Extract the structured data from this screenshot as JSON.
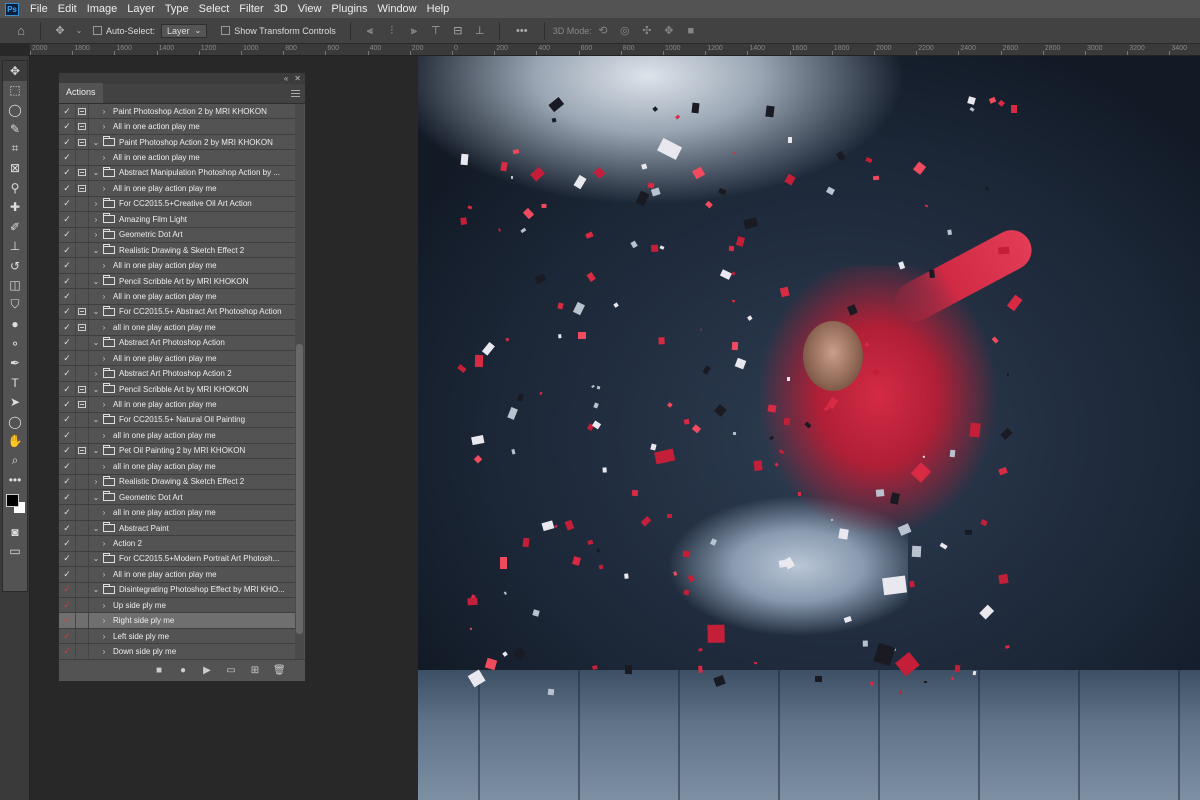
{
  "app": {
    "logo_text": "Ps"
  },
  "menubar": [
    "File",
    "Edit",
    "Image",
    "Layer",
    "Type",
    "Select",
    "Filter",
    "3D",
    "View",
    "Plugins",
    "Window",
    "Help"
  ],
  "options_bar": {
    "auto_select_label": "Auto-Select:",
    "auto_select_value": "Layer",
    "show_transform_label": "Show Transform Controls",
    "more_label": "•••",
    "mode_3d_label": "3D Mode:"
  },
  "ruler_top": [
    "2000",
    "1800",
    "1600",
    "1400",
    "1200",
    "1000",
    "800",
    "600",
    "400",
    "200",
    "0",
    "200",
    "400",
    "600",
    "800",
    "1000",
    "1200",
    "1400",
    "1600",
    "1800",
    "2000",
    "2200",
    "2400",
    "2600",
    "2800",
    "3000",
    "3200",
    "3400"
  ],
  "tools": [
    {
      "name": "move-tool-icon",
      "glyph": "✥"
    },
    {
      "name": "marquee-tool-icon",
      "glyph": "⬚"
    },
    {
      "name": "lasso-tool-icon",
      "glyph": "◯"
    },
    {
      "name": "quick-select-tool-icon",
      "glyph": "✎"
    },
    {
      "name": "crop-tool-icon",
      "glyph": "⌗"
    },
    {
      "name": "frame-tool-icon",
      "glyph": "⊠"
    },
    {
      "name": "eyedropper-tool-icon",
      "glyph": "⚲"
    },
    {
      "name": "healing-brush-tool-icon",
      "glyph": "✚"
    },
    {
      "name": "brush-tool-icon",
      "glyph": "✐"
    },
    {
      "name": "clone-stamp-tool-icon",
      "glyph": "⊥"
    },
    {
      "name": "history-brush-tool-icon",
      "glyph": "↺"
    },
    {
      "name": "eraser-tool-icon",
      "glyph": "◫"
    },
    {
      "name": "paint-bucket-tool-icon",
      "glyph": "⛉"
    },
    {
      "name": "blur-tool-icon",
      "glyph": "●"
    },
    {
      "name": "dodge-tool-icon",
      "glyph": "⚬"
    },
    {
      "name": "pen-tool-icon",
      "glyph": "✒"
    },
    {
      "name": "type-tool-icon",
      "glyph": "T"
    },
    {
      "name": "path-select-tool-icon",
      "glyph": "➤"
    },
    {
      "name": "ellipse-tool-icon",
      "glyph": "◯"
    },
    {
      "name": "hand-tool-icon",
      "glyph": "✋"
    },
    {
      "name": "zoom-tool-icon",
      "glyph": "⌕"
    },
    {
      "name": "more-tools-icon",
      "glyph": "•••"
    }
  ],
  "actions_panel": {
    "tab_label": "Actions",
    "rows": [
      {
        "check": "✓",
        "red": false,
        "dialog": true,
        "twirl": "›",
        "folder": false,
        "label": "Paint Photoshop Action 2 by MRI KHOKON"
      },
      {
        "check": "✓",
        "red": false,
        "dialog": true,
        "twirl": "›",
        "folder": false,
        "label": "All in one action play me"
      },
      {
        "check": "✓",
        "red": false,
        "dialog": true,
        "twirl": "⌄",
        "folder": true,
        "label": "Paint Photoshop Action 2 by MRI KHOKON"
      },
      {
        "check": "✓",
        "red": false,
        "dialog": false,
        "twirl": "›",
        "folder": false,
        "label": "All in one action play me"
      },
      {
        "check": "✓",
        "red": false,
        "dialog": true,
        "twirl": "⌄",
        "folder": true,
        "label": "Abstract Manipulation Photoshop Action by ..."
      },
      {
        "check": "✓",
        "red": false,
        "dialog": true,
        "twirl": "›",
        "folder": false,
        "label": "All in one play action play me"
      },
      {
        "check": "✓",
        "red": false,
        "dialog": false,
        "twirl": "›",
        "folder": true,
        "label": "For CC2015.5+Creative Oil Art Action"
      },
      {
        "check": "✓",
        "red": false,
        "dialog": false,
        "twirl": "›",
        "folder": true,
        "label": "Amazing Film Light"
      },
      {
        "check": "✓",
        "red": false,
        "dialog": false,
        "twirl": "›",
        "folder": true,
        "label": "Geometric Dot Art"
      },
      {
        "check": "✓",
        "red": false,
        "dialog": false,
        "twirl": "⌄",
        "folder": true,
        "label": "Realistic Drawing & Sketch Effect 2"
      },
      {
        "check": "✓",
        "red": false,
        "dialog": false,
        "twirl": "›",
        "folder": false,
        "label": "All in one play action play me"
      },
      {
        "check": "✓",
        "red": false,
        "dialog": false,
        "twirl": "⌄",
        "folder": true,
        "label": "Pencil Scribble Art by MRI KHOKON"
      },
      {
        "check": "✓",
        "red": false,
        "dialog": false,
        "twirl": "›",
        "folder": false,
        "label": "All in one play action play me"
      },
      {
        "check": "✓",
        "red": false,
        "dialog": true,
        "twirl": "⌄",
        "folder": true,
        "label": "For CC2015.5+ Abstract Art Photoshop Action"
      },
      {
        "check": "✓",
        "red": false,
        "dialog": true,
        "twirl": "›",
        "folder": false,
        "label": "all in one play action play me"
      },
      {
        "check": "✓",
        "red": false,
        "dialog": false,
        "twirl": "⌄",
        "folder": true,
        "label": "Abstract Art Photoshop Action"
      },
      {
        "check": "✓",
        "red": false,
        "dialog": false,
        "twirl": "›",
        "folder": false,
        "label": "All in one play action play me"
      },
      {
        "check": "✓",
        "red": false,
        "dialog": false,
        "twirl": "›",
        "folder": true,
        "label": "Abstract Art Photoshop Action 2"
      },
      {
        "check": "✓",
        "red": false,
        "dialog": true,
        "twirl": "⌄",
        "folder": true,
        "label": "Pencil Scribble Art by MRI KHOKON"
      },
      {
        "check": "✓",
        "red": false,
        "dialog": true,
        "twirl": "›",
        "folder": false,
        "label": "All in one play action play me"
      },
      {
        "check": "✓",
        "red": false,
        "dialog": false,
        "twirl": "⌄",
        "folder": true,
        "label": "For CC2015.5+ Natural Oil Painting"
      },
      {
        "check": "✓",
        "red": false,
        "dialog": false,
        "twirl": "›",
        "folder": false,
        "label": "all in one play action play me"
      },
      {
        "check": "✓",
        "red": false,
        "dialog": true,
        "twirl": "⌄",
        "folder": true,
        "label": "Pet Oil Painting 2 by MRI KHOKON"
      },
      {
        "check": "✓",
        "red": false,
        "dialog": false,
        "twirl": "›",
        "folder": false,
        "label": "all in one play action play me"
      },
      {
        "check": "✓",
        "red": false,
        "dialog": false,
        "twirl": "›",
        "folder": true,
        "label": "Realistic Drawing & Sketch Effect 2"
      },
      {
        "check": "✓",
        "red": false,
        "dialog": false,
        "twirl": "⌄",
        "folder": true,
        "label": "Geometric Dot Art"
      },
      {
        "check": "✓",
        "red": false,
        "dialog": false,
        "twirl": "›",
        "folder": false,
        "label": "all in one play action play me"
      },
      {
        "check": "✓",
        "red": false,
        "dialog": false,
        "twirl": "⌄",
        "folder": true,
        "label": "Abstract Paint"
      },
      {
        "check": "✓",
        "red": false,
        "dialog": false,
        "twirl": "›",
        "folder": false,
        "label": "Action 2"
      },
      {
        "check": "✓",
        "red": false,
        "dialog": false,
        "twirl": "⌄",
        "folder": true,
        "label": "For CC2015.5+Modern Portrait  Art Photosh..."
      },
      {
        "check": "✓",
        "red": false,
        "dialog": false,
        "twirl": "›",
        "folder": false,
        "label": "All in one play action play me"
      },
      {
        "check": "✓",
        "red": true,
        "dialog": false,
        "twirl": "⌄",
        "folder": true,
        "label": "Disintegrating Photoshop Effect by MRI KHO..."
      },
      {
        "check": "✓",
        "red": true,
        "dialog": false,
        "twirl": "›",
        "folder": false,
        "label": "Up side ply me"
      },
      {
        "check": "✓",
        "red": true,
        "dialog": false,
        "twirl": "›",
        "folder": false,
        "label": "Right side ply me",
        "selected": true
      },
      {
        "check": "✓",
        "red": true,
        "dialog": false,
        "twirl": "›",
        "folder": false,
        "label": "Left side ply me"
      },
      {
        "check": "✓",
        "red": true,
        "dialog": false,
        "twirl": "›",
        "folder": false,
        "label": "Down side ply me"
      }
    ],
    "footer_buttons": [
      {
        "name": "stop-button-icon",
        "glyph": "■"
      },
      {
        "name": "record-button-icon",
        "glyph": "●"
      },
      {
        "name": "play-button-icon",
        "glyph": "▶"
      },
      {
        "name": "new-set-button-icon",
        "glyph": "▭"
      },
      {
        "name": "new-action-button-icon",
        "glyph": "⊞"
      },
      {
        "name": "delete-button-icon",
        "glyph": "🗑"
      }
    ]
  },
  "colors": {
    "accent": "#31a8ff",
    "record_red": "#e0383a",
    "panel_bg": "#535353"
  }
}
